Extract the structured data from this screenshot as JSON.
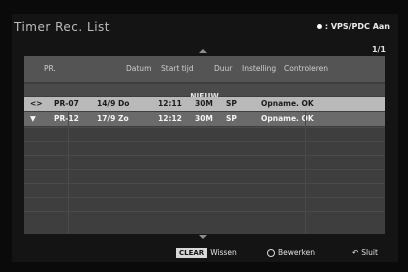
{
  "screen": {
    "title": "Timer Rec. List",
    "vps_label": ": VPS/PDC Aan",
    "page": "1/1"
  },
  "columns": [
    "PR.",
    "Datum",
    "Start tijd",
    "Duur",
    "Instelling",
    "Controleren"
  ],
  "section_label": "NIEUW",
  "rows": [
    {
      "pr": "PR-07",
      "date": "14/9 Do",
      "start": "12:11",
      "duration": "30M",
      "mode": "SP",
      "status": "Opname. OK",
      "icon": "record-arrow-icon"
    },
    {
      "pr": "PR-12",
      "date": "17/9 Zo",
      "start": "12:12",
      "duration": "30M",
      "mode": "SP",
      "status": "Opname. OK",
      "icon": "vps-dot-icon"
    }
  ],
  "footer": {
    "clear_label": "CLEAR",
    "wissen": "Wissen",
    "bewerken": "Bewerken",
    "sluit": "Sluit"
  }
}
